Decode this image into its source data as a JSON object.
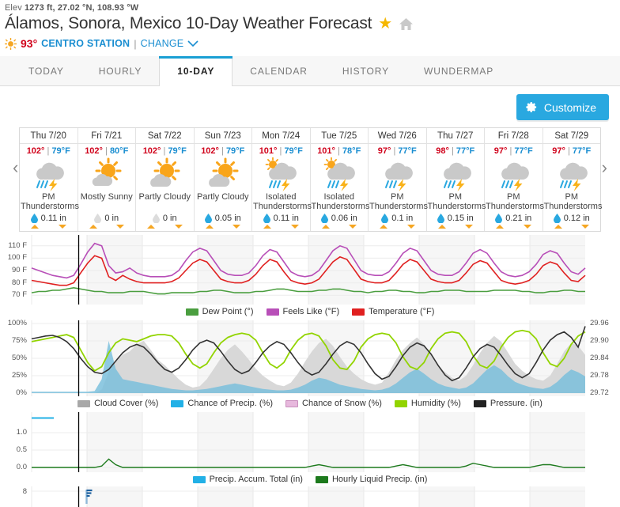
{
  "header": {
    "elev_prefix": "Elev",
    "elev_value": "1273 ft, 27.02 °N, 108.93 °W",
    "title": "Álamos, Sonora, Mexico 10-Day Weather Forecast",
    "star_icon": "star-icon",
    "home_icon": "home-icon",
    "current_temp": "93°",
    "station": "CENTRO STATION",
    "divider": "|",
    "change_label": "CHANGE",
    "chevron": "chevron-down-icon"
  },
  "tabs": [
    {
      "label": "TODAY",
      "active": false
    },
    {
      "label": "HOURLY",
      "active": false
    },
    {
      "label": "10-DAY",
      "active": true
    },
    {
      "label": "CALENDAR",
      "active": false
    },
    {
      "label": "HISTORY",
      "active": false
    },
    {
      "label": "WUNDERMAP",
      "active": false
    }
  ],
  "toolbar": {
    "customize_label": "Customize",
    "customize_color": "#29a8e0"
  },
  "forecast": {
    "prev_arrow": "‹",
    "next_arrow": "›",
    "days": [
      {
        "date": "Thu 7/20",
        "high": "102°",
        "low": "79°F",
        "sep": "|",
        "icon": "thunderstorm-icon",
        "condition": "PM Thunderstorms",
        "precip": "0.11 in",
        "precip_wet": true
      },
      {
        "date": "Fri 7/21",
        "high": "102°",
        "low": "80°F",
        "sep": "|",
        "icon": "mostly-sunny-icon",
        "condition": "Mostly Sunny",
        "precip": "0 in",
        "precip_wet": false
      },
      {
        "date": "Sat 7/22",
        "high": "102°",
        "low": "79°F",
        "sep": "|",
        "icon": "partly-cloudy-icon",
        "condition": "Partly Cloudy",
        "precip": "0 in",
        "precip_wet": false
      },
      {
        "date": "Sun 7/23",
        "high": "102°",
        "low": "79°F",
        "sep": "|",
        "icon": "partly-cloudy-icon",
        "condition": "Partly Cloudy",
        "precip": "0.05 in",
        "precip_wet": true
      },
      {
        "date": "Mon 7/24",
        "high": "101°",
        "low": "79°F",
        "sep": "|",
        "icon": "isolated-thunderstorm-icon",
        "condition": "Isolated Thunderstorms",
        "precip": "0.11 in",
        "precip_wet": true
      },
      {
        "date": "Tue 7/25",
        "high": "101°",
        "low": "78°F",
        "sep": "|",
        "icon": "isolated-thunderstorm-icon",
        "condition": "Isolated Thunderstorms",
        "precip": "0.06 in",
        "precip_wet": true
      },
      {
        "date": "Wed 7/26",
        "high": "97°",
        "low": "77°F",
        "sep": "|",
        "icon": "thunderstorm-icon",
        "condition": "PM Thunderstorms",
        "precip": "0.1 in",
        "precip_wet": true
      },
      {
        "date": "Thu 7/27",
        "high": "98°",
        "low": "77°F",
        "sep": "|",
        "icon": "thunderstorm-icon",
        "condition": "PM Thunderstorms",
        "precip": "0.15 in",
        "precip_wet": true
      },
      {
        "date": "Fri 7/28",
        "high": "97°",
        "low": "77°F",
        "sep": "|",
        "icon": "thunderstorm-icon",
        "condition": "PM Thunderstorms",
        "precip": "0.21 in",
        "precip_wet": true
      },
      {
        "date": "Sat 7/29",
        "high": "97°",
        "low": "77°F",
        "sep": "|",
        "icon": "thunderstorm-icon",
        "condition": "PM Thunderstorms",
        "precip": "0.12 in",
        "precip_wet": true
      }
    ]
  },
  "chart_data": [
    {
      "type": "line",
      "name": "temperature-chart",
      "title": "",
      "xlabel": "",
      "ylabel": "°F",
      "ylim": [
        65,
        115
      ],
      "yticks": [
        "70 F",
        "80 F",
        "90 F",
        "100 F",
        "110 F"
      ],
      "ytick_values": [
        70,
        80,
        90,
        100,
        110
      ],
      "grid": true,
      "legend_position": "bottom",
      "series": [
        {
          "name": "Dew Point (°)",
          "color": "#4a9e3f",
          "values": [
            72,
            73,
            73,
            74,
            74,
            75,
            76,
            75,
            74,
            73,
            73,
            72,
            72,
            72,
            73,
            73,
            73,
            72,
            71,
            71,
            72,
            72,
            72,
            72,
            73,
            73,
            74,
            74,
            73,
            72,
            72,
            72,
            73,
            73,
            74,
            75,
            75,
            74,
            73,
            73,
            73,
            74,
            74,
            75,
            75,
            74,
            73,
            73,
            72,
            73,
            73,
            74,
            74,
            73,
            73,
            72,
            72,
            73,
            73,
            74,
            74,
            74,
            73,
            73,
            73,
            73,
            74,
            74,
            74,
            74,
            73,
            73,
            72,
            72,
            73,
            73,
            74,
            74,
            73,
            73
          ]
        },
        {
          "name": "Feels Like (°F)",
          "color": "#b84fb8",
          "values": [
            92,
            90,
            88,
            86,
            85,
            84,
            86,
            95,
            105,
            112,
            110,
            94,
            88,
            89,
            92,
            88,
            86,
            85,
            85,
            85,
            86,
            90,
            98,
            105,
            108,
            106,
            98,
            90,
            87,
            86,
            86,
            88,
            94,
            102,
            107,
            105,
            97,
            89,
            86,
            85,
            86,
            90,
            98,
            106,
            110,
            108,
            99,
            90,
            87,
            86,
            86,
            89,
            96,
            104,
            108,
            106,
            98,
            90,
            87,
            86,
            86,
            89,
            96,
            104,
            107,
            104,
            96,
            89,
            86,
            85,
            86,
            89,
            95,
            103,
            106,
            104,
            96,
            89,
            87,
            92
          ]
        },
        {
          "name": "Temperature (°F)",
          "color": "#e02020",
          "values": [
            82,
            81,
            80,
            79,
            78,
            78,
            80,
            88,
            96,
            102,
            100,
            85,
            82,
            86,
            83,
            81,
            80,
            80,
            80,
            80,
            81,
            84,
            90,
            96,
            99,
            97,
            90,
            83,
            81,
            80,
            80,
            82,
            87,
            94,
            99,
            97,
            89,
            82,
            80,
            79,
            80,
            83,
            90,
            97,
            101,
            99,
            91,
            83,
            81,
            80,
            80,
            82,
            88,
            95,
            99,
            97,
            90,
            83,
            81,
            80,
            80,
            82,
            88,
            95,
            98,
            96,
            89,
            82,
            80,
            79,
            80,
            82,
            87,
            94,
            97,
            95,
            88,
            82,
            81,
            86
          ]
        }
      ]
    },
    {
      "type": "area-line",
      "name": "humidity-cloud-precip-chart",
      "ylim": [
        0,
        100
      ],
      "yticks": [
        "0%",
        "25%",
        "50%",
        "75%",
        "100%"
      ],
      "ytick_values": [
        0,
        25,
        50,
        75,
        100
      ],
      "y2ticks": [
        "29.72",
        "29.78",
        "29.84",
        "29.90",
        "29.96"
      ],
      "y2lim": [
        29.7,
        29.98
      ],
      "grid": true,
      "legend_position": "bottom",
      "series": [
        {
          "name": "Cloud Cover (%)",
          "color": "#a8a8a8",
          "kind": "area",
          "values": [
            0,
            0,
            0,
            0,
            0,
            0,
            0,
            0,
            0,
            0,
            5,
            30,
            45,
            55,
            60,
            70,
            75,
            62,
            48,
            40,
            30,
            20,
            12,
            8,
            10,
            20,
            35,
            50,
            62,
            70,
            60,
            48,
            35,
            25,
            18,
            12,
            10,
            15,
            28,
            45,
            60,
            72,
            78,
            68,
            52,
            38,
            28,
            20,
            15,
            12,
            15,
            30,
            48,
            62,
            72,
            80,
            70,
            55,
            40,
            30,
            22,
            18,
            25,
            40,
            58,
            72,
            82,
            74,
            58,
            42,
            32,
            25,
            20,
            18,
            25,
            42,
            60,
            72,
            68,
            55
          ]
        },
        {
          "name": "Chance of Precip. (%)",
          "color": "#2fb3e0",
          "kind": "area",
          "values": [
            2,
            2,
            2,
            2,
            2,
            2,
            2,
            2,
            2,
            3,
            20,
            75,
            35,
            20,
            18,
            16,
            14,
            12,
            10,
            8,
            6,
            5,
            4,
            4,
            5,
            6,
            8,
            10,
            12,
            14,
            12,
            10,
            8,
            6,
            5,
            4,
            4,
            5,
            8,
            12,
            18,
            22,
            20,
            16,
            12,
            10,
            8,
            6,
            5,
            4,
            5,
            8,
            14,
            22,
            30,
            35,
            28,
            20,
            14,
            10,
            8,
            6,
            8,
            14,
            24,
            34,
            40,
            34,
            24,
            16,
            12,
            9,
            7,
            6,
            9,
            16,
            26,
            34,
            30,
            24
          ]
        },
        {
          "name": "Chance of Snow (%)",
          "color": "#d59ec9",
          "kind": "area",
          "values": [
            0,
            0,
            0,
            0,
            0,
            0,
            0,
            0,
            0,
            0,
            0,
            0,
            0,
            0,
            0,
            0,
            0,
            0,
            0,
            0,
            0,
            0,
            0,
            0,
            0,
            0,
            0,
            0,
            0,
            0,
            0,
            0,
            0,
            0,
            0,
            0,
            0,
            0,
            0,
            0,
            0,
            0,
            0,
            0,
            0,
            0,
            0,
            0,
            0,
            0,
            0,
            0,
            0,
            0,
            0,
            0,
            0,
            0,
            0,
            0,
            0,
            0,
            0,
            0,
            0,
            0,
            0,
            0,
            0,
            0,
            0,
            0,
            0,
            0,
            0,
            0,
            0,
            0,
            0,
            0
          ]
        },
        {
          "name": "Humidity (%)",
          "color": "#92d400",
          "kind": "line",
          "values": [
            74,
            76,
            78,
            80,
            82,
            84,
            80,
            62,
            44,
            32,
            38,
            58,
            72,
            78,
            76,
            74,
            78,
            82,
            84,
            84,
            82,
            72,
            56,
            42,
            36,
            42,
            58,
            72,
            80,
            84,
            86,
            84,
            76,
            58,
            42,
            36,
            44,
            62,
            76,
            84,
            86,
            82,
            68,
            48,
            36,
            34,
            46,
            66,
            78,
            84,
            86,
            84,
            72,
            52,
            38,
            34,
            44,
            64,
            78,
            86,
            88,
            86,
            74,
            54,
            40,
            36,
            46,
            66,
            80,
            88,
            90,
            88,
            78,
            58,
            42,
            38,
            50,
            70,
            82,
            88
          ]
        },
        {
          "name": "Pressure. (in)",
          "color": "#333333",
          "kind": "line",
          "values": [
            78,
            80,
            82,
            83,
            80,
            74,
            64,
            50,
            38,
            30,
            28,
            34,
            46,
            58,
            66,
            70,
            66,
            56,
            44,
            34,
            30,
            36,
            48,
            62,
            72,
            76,
            72,
            60,
            46,
            34,
            28,
            32,
            44,
            58,
            68,
            74,
            70,
            58,
            44,
            32,
            26,
            30,
            42,
            56,
            68,
            74,
            70,
            58,
            42,
            28,
            20,
            24,
            38,
            54,
            66,
            72,
            68,
            56,
            40,
            26,
            18,
            22,
            36,
            52,
            64,
            70,
            66,
            54,
            40,
            28,
            22,
            28,
            44,
            62,
            76,
            84,
            88,
            80,
            66,
            96
          ]
        }
      ]
    },
    {
      "type": "area-line",
      "name": "precipitation-chart",
      "ylim": [
        0,
        1.5
      ],
      "yticks": [
        "0.0",
        "0.5",
        "1.0"
      ],
      "ytick_values": [
        0.0,
        0.5,
        1.0
      ],
      "grid": true,
      "legend_position": "bottom",
      "series": [
        {
          "name": "Precip. Accum. Total (in)",
          "color": "#2fb3e0",
          "kind": "line",
          "values": [
            1.42,
            1.42,
            1.42,
            1.42,
            1.42
          ]
        },
        {
          "name": "Hourly Liquid Precip. (in)",
          "color": "#1d7a1d",
          "kind": "line",
          "values": [
            0.0,
            0.0,
            0.0,
            0.0,
            0.0,
            0.0,
            0.0,
            0.0,
            0.0,
            0.0,
            0.01,
            0.06,
            0.02,
            0.0,
            0.0,
            0.0,
            0.0,
            0.0,
            0.0,
            0.0,
            0.0,
            0.0,
            0.0,
            0.0,
            0.0,
            0.0,
            0.0,
            0.0,
            0.0,
            0.0,
            0.0,
            0.0,
            0.0,
            0.0,
            0.0,
            0.0,
            0.0,
            0.0,
            0.0,
            0.0,
            0.01,
            0.02,
            0.01,
            0.0,
            0.0,
            0.0,
            0.0,
            0.0,
            0.0,
            0.0,
            0.0,
            0.0,
            0.01,
            0.02,
            0.01,
            0.0,
            0.0,
            0.0,
            0.0,
            0.0,
            0.0,
            0.0,
            0.01,
            0.03,
            0.02,
            0.01,
            0.0,
            0.0,
            0.0,
            0.0,
            0.0,
            0.0,
            0.01,
            0.02,
            0.02,
            0.01,
            0.0,
            0.0,
            0.0,
            0.0
          ]
        }
      ]
    }
  ],
  "legends": {
    "chart1": [
      {
        "label": "Dew Point (°)",
        "color": "#4a9e3f"
      },
      {
        "label": "Feels Like (°F)",
        "color": "#b84fb8"
      },
      {
        "label": "Temperature (°F)",
        "color": "#e02020"
      }
    ],
    "chart2": [
      {
        "label": "Cloud Cover (%)",
        "color": "#a8a8a8"
      },
      {
        "label": "Chance of Precip. (%)",
        "color": "#22b0e6"
      },
      {
        "label": "Chance of Snow (%)",
        "color": "#e7b8dd"
      },
      {
        "label": "Humidity (%)",
        "color": "#92d400"
      },
      {
        "label": "Pressure. (in)",
        "color": "#222222"
      }
    ],
    "chart3": [
      {
        "label": "Precip. Accum. Total (in)",
        "color": "#22b0e6"
      },
      {
        "label": "Hourly Liquid Precip. (in)",
        "color": "#1d7a1d"
      }
    ]
  }
}
